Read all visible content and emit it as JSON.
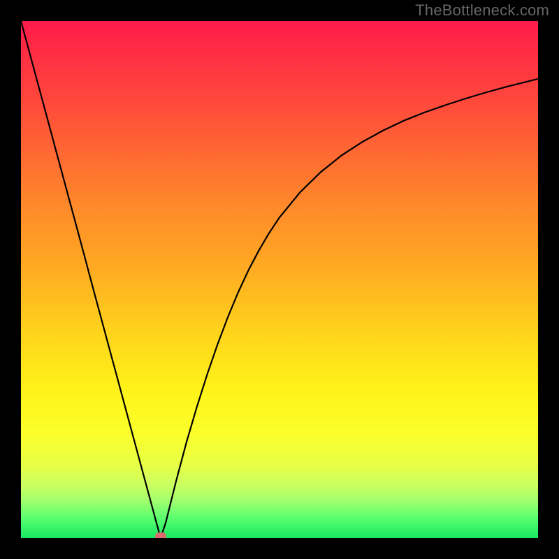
{
  "watermark": "TheBottleneck.com",
  "chart_data": {
    "type": "line",
    "title": "",
    "xlabel": "",
    "ylabel": "",
    "xlim": [
      0,
      100
    ],
    "ylim": [
      0,
      100
    ],
    "grid": false,
    "series": [
      {
        "name": "curve",
        "x": [
          0,
          2,
          4,
          6,
          8,
          10,
          12,
          14,
          16,
          18,
          20,
          22,
          24,
          26,
          27,
          28,
          29,
          30,
          32,
          34,
          36,
          38,
          40,
          42,
          44,
          46,
          48,
          50,
          54,
          58,
          62,
          66,
          70,
          74,
          78,
          82,
          86,
          90,
          94,
          98,
          100
        ],
        "y": [
          100,
          92.6,
          85.2,
          77.8,
          70.4,
          63.0,
          55.6,
          48.1,
          40.7,
          33.3,
          25.9,
          18.5,
          11.1,
          3.7,
          0.0,
          3.0,
          7.0,
          11.0,
          18.5,
          25.3,
          31.6,
          37.4,
          42.7,
          47.5,
          51.8,
          55.6,
          59.0,
          62.0,
          66.9,
          70.8,
          74.0,
          76.6,
          78.8,
          80.7,
          82.3,
          83.7,
          85.0,
          86.2,
          87.3,
          88.3,
          88.8
        ]
      }
    ],
    "marker": {
      "x": 27,
      "y": 0.3
    },
    "colors": {
      "curve": "#000000",
      "marker": "#d86b6f",
      "gradient_top": "#ff1b4a",
      "gradient_bottom": "#17e861"
    }
  }
}
